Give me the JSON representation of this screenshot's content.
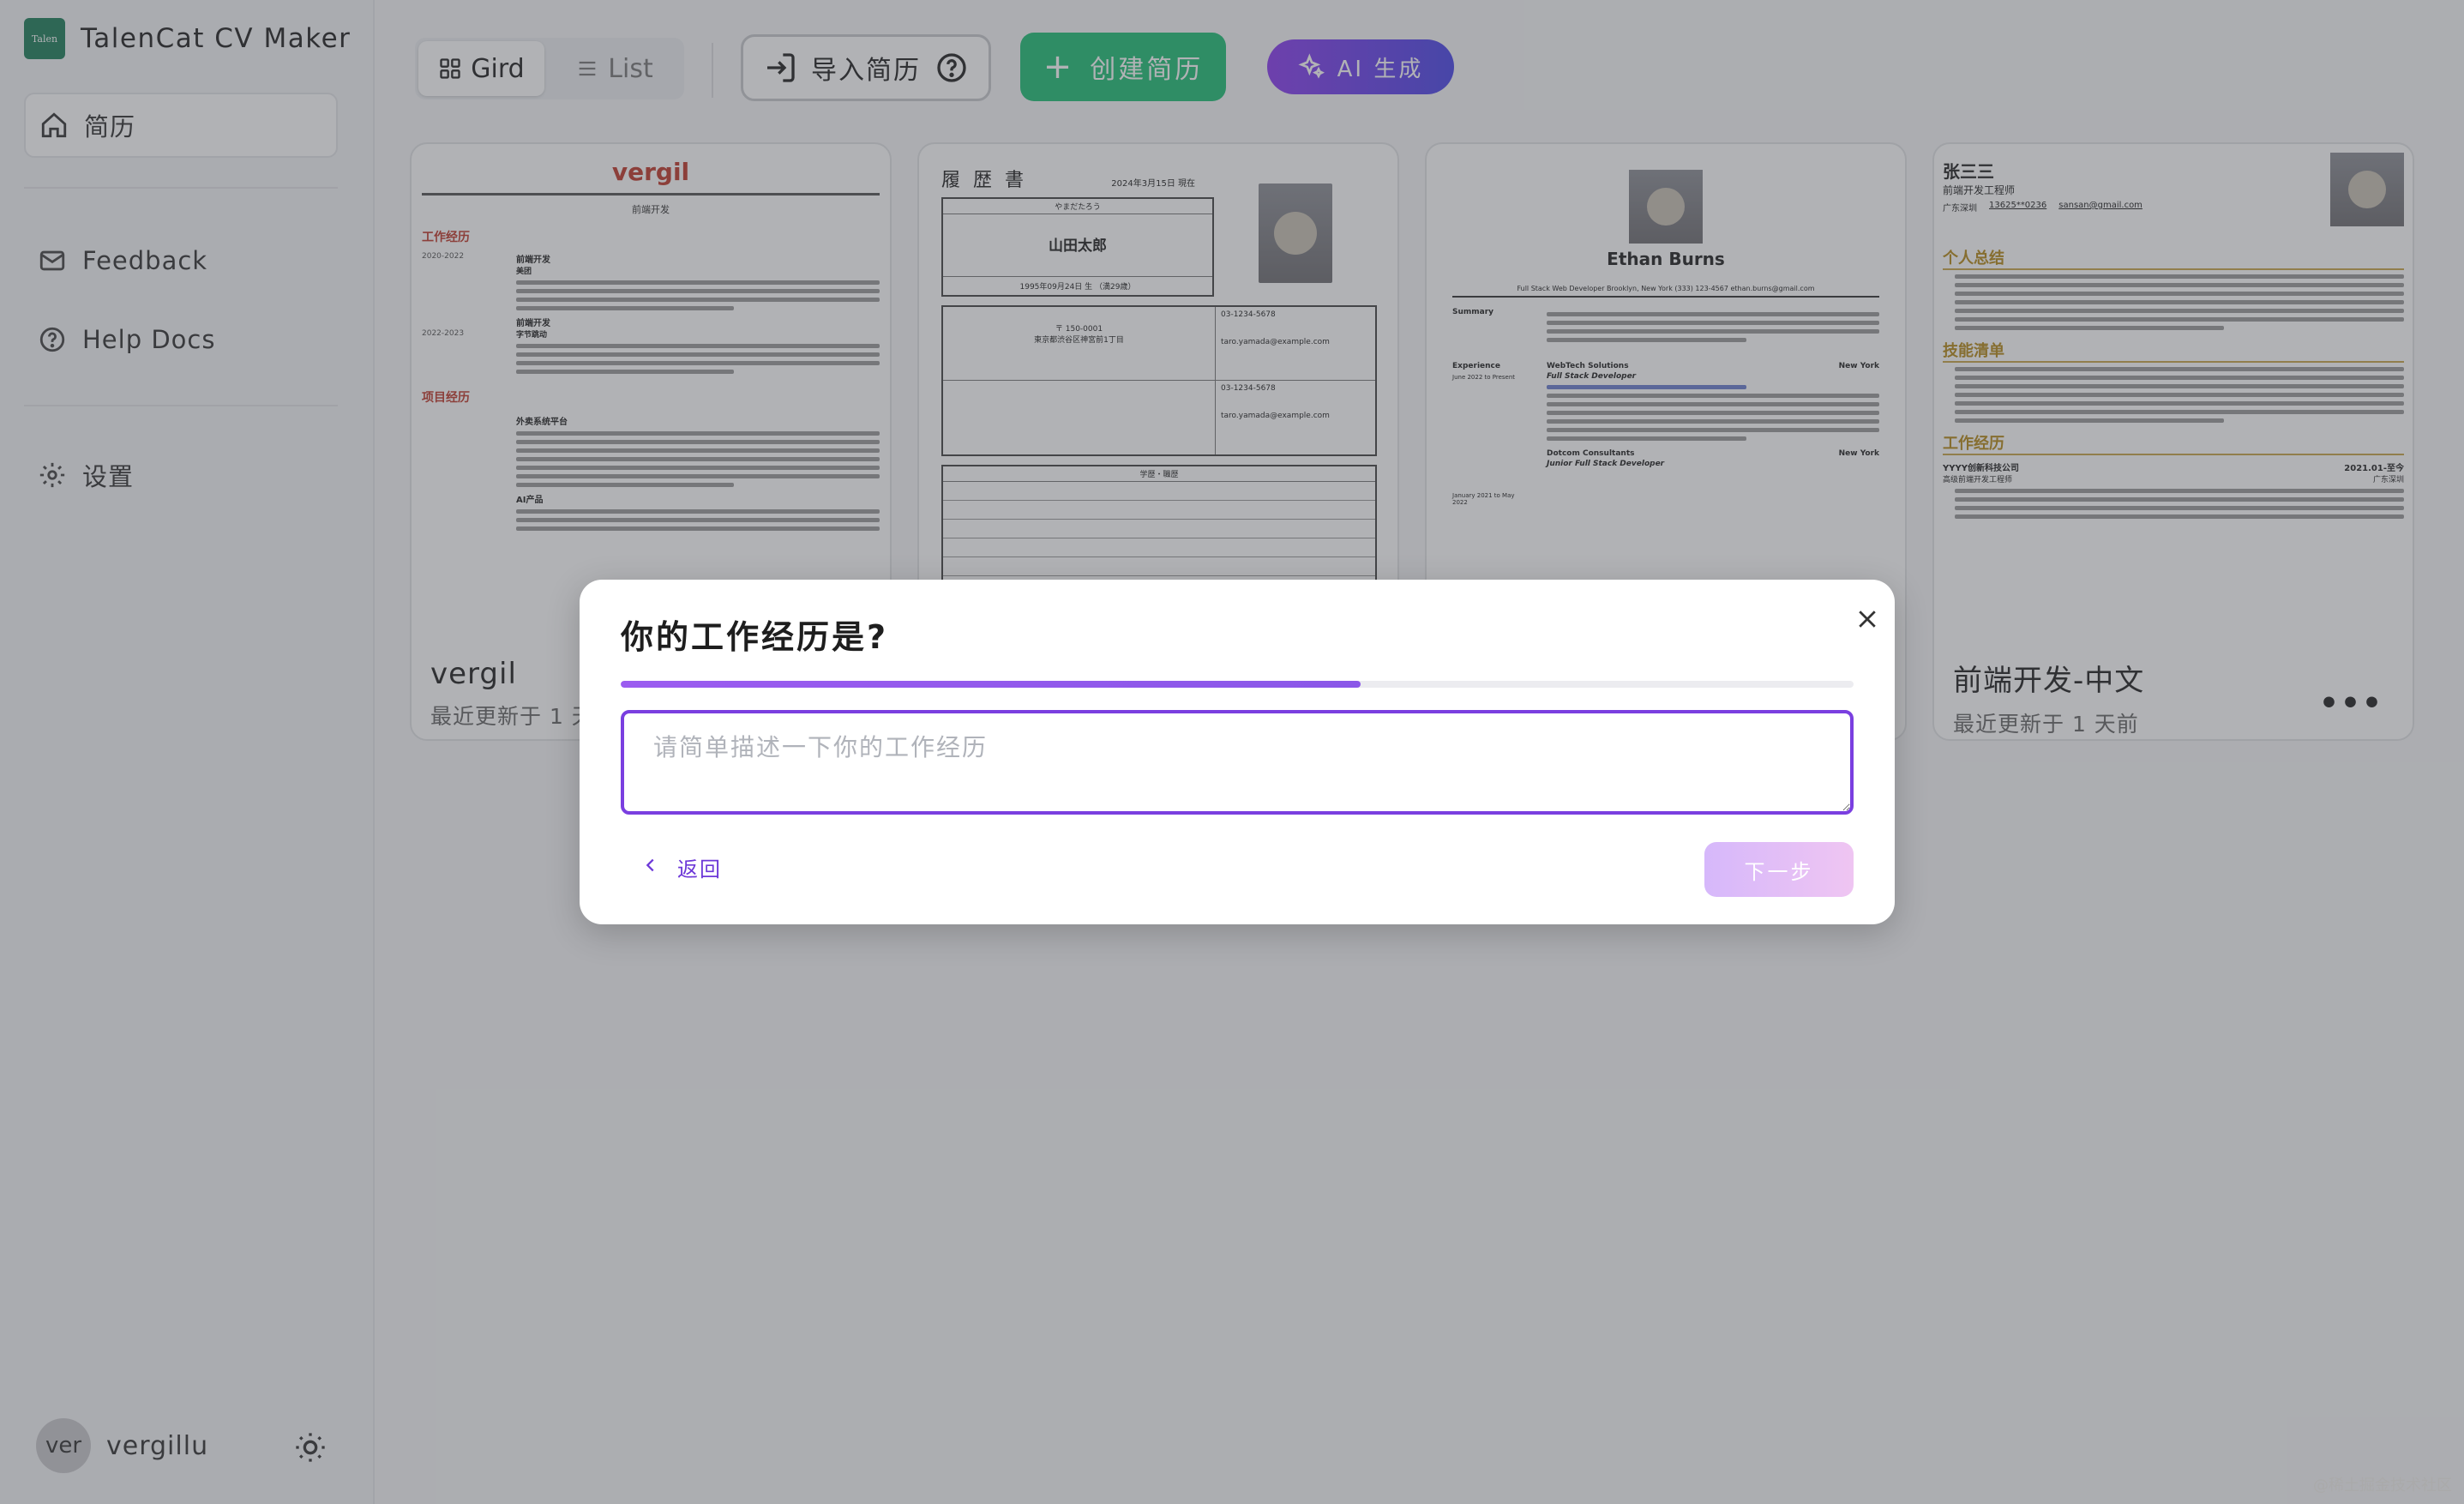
{
  "app": {
    "title": "TalenCat CV Maker",
    "logo_text": "TalenCat"
  },
  "sidebar": {
    "items": [
      {
        "label": "简历",
        "icon": "home-icon",
        "active": true
      },
      {
        "label": "Feedback",
        "icon": "mail-icon"
      },
      {
        "label": "Help Docs",
        "icon": "help-circle-icon"
      },
      {
        "label": "设置",
        "icon": "gear-icon"
      }
    ],
    "user": {
      "avatar_text": "ver",
      "name": "vergillu"
    }
  },
  "toolbar": {
    "grid_label": "Gird",
    "list_label": "List",
    "import_label": "导入简历",
    "create_label": "创建简历",
    "ai_label": "AI 生成"
  },
  "cards": [
    {
      "title": "vergil",
      "updated": "最近更新于 1 天前",
      "preview": {
        "name": "vergil",
        "role": "前端开发",
        "section1": "工作经历",
        "section2": "项目经历",
        "job1": "前端开发",
        "job1_co": "美团",
        "job2": "前端开发",
        "job2_co": "字节跳动",
        "proj1": "外卖系统平台",
        "proj2": "AI产品",
        "date1": "2020-2022",
        "date2": "2022-2023"
      }
    },
    {
      "title": "",
      "updated": "",
      "preview": {
        "heading": "履 歴 書",
        "date": "2024年3月15日 現在",
        "name": "山田太郎",
        "kana": "やまだたろう",
        "birth": "1995年09月24日 生 （満29歳）",
        "phone": "03-1234-5678",
        "email": "taro.yamada@example.com",
        "address": "東京都渋谷区神宮前1丁目",
        "zip": "〒 150-0001",
        "history_header": "学歴・職歴"
      }
    },
    {
      "title": "",
      "updated": "",
      "preview": {
        "name": "Ethan Burns",
        "subtitle": "Full Stack Web Developer  Brooklyn, New York  (333) 123-4567  ethan.burns@gmail.com",
        "summary_label": "Summary",
        "experience_label": "Experience",
        "company1": "WebTech Solutions",
        "location1": "New York",
        "role1": "Full Stack Developer",
        "company2": "Dotcom Consultants",
        "location2": "New York",
        "role2": "Junior Full Stack Developer",
        "period1": "June 2022 to Present",
        "period2": "January 2021 to May 2022"
      }
    },
    {
      "title": "前端开发-中文",
      "updated": "最近更新于 1 天前",
      "preview": {
        "name": "张三三",
        "role": "前端开发工程师",
        "location": "广东深圳",
        "phone": "13625**0236",
        "email": "sansan@gmail.com",
        "section1": "个人总结",
        "section2": "技能清单",
        "section3": "工作经历",
        "company": "YYYY创新科技公司",
        "period": "2021.01-至今",
        "job": "高级前端开发工程师",
        "job_loc": "广东深圳"
      }
    }
  ],
  "modal": {
    "title": "你的工作经历是?",
    "progress": 0.6,
    "input_placeholder": "请简单描述一下你的工作经历",
    "input_value": "",
    "back_label": "返回",
    "next_label": "下一步"
  },
  "watermark": "@稀土掘金技术社区",
  "colors": {
    "accent": "#7a3fe0",
    "create_green": "#1fbf75",
    "ai_gradient_start": "#8b3cf0",
    "ai_gradient_end": "#4a46e8"
  }
}
